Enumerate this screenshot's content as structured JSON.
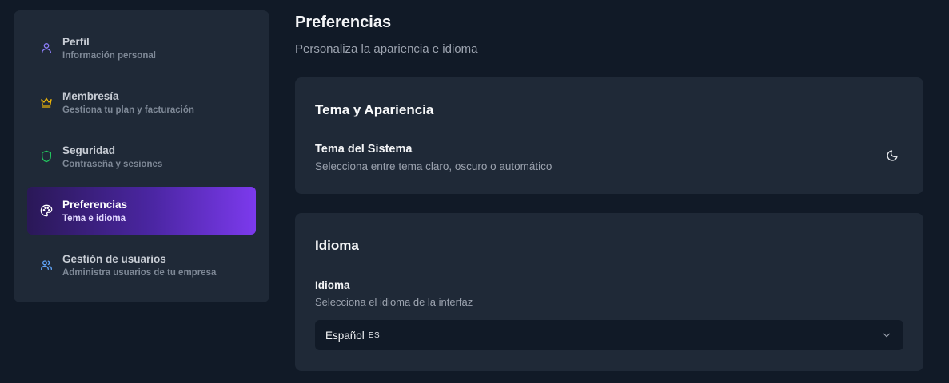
{
  "sidebar": {
    "items": [
      {
        "label": "Perfil",
        "desc": "Información personal",
        "icon": "user-icon",
        "color": "#8b7cf6"
      },
      {
        "label": "Membresía",
        "desc": "Gestiona tu plan y facturación",
        "icon": "crown-icon",
        "color": "#eab308"
      },
      {
        "label": "Seguridad",
        "desc": "Contraseña y sesiones",
        "icon": "shield-icon",
        "color": "#22c55e"
      },
      {
        "label": "Preferencias",
        "desc": "Tema e idioma",
        "icon": "palette-icon",
        "color": "#ffffff",
        "active": true
      },
      {
        "label": "Gestión de usuarios",
        "desc": "Administra usuarios de tu empresa",
        "icon": "users-icon",
        "color": "#60a5fa"
      }
    ]
  },
  "main": {
    "title": "Preferencias",
    "subtitle": "Personaliza la apariencia e idioma",
    "theme_card": {
      "title": "Tema y Apariencia",
      "setting_label": "Tema del Sistema",
      "setting_desc": "Selecciona entre tema claro, oscuro o automático",
      "toggle_icon": "moon-icon"
    },
    "language_card": {
      "title": "Idioma",
      "setting_label": "Idioma",
      "setting_desc": "Selecciona el idioma de la interfaz",
      "selected_value": "Español",
      "selected_code": "ES"
    }
  },
  "colors": {
    "background": "#111a27",
    "card": "#1f2937",
    "accent": "#7c3aed"
  }
}
